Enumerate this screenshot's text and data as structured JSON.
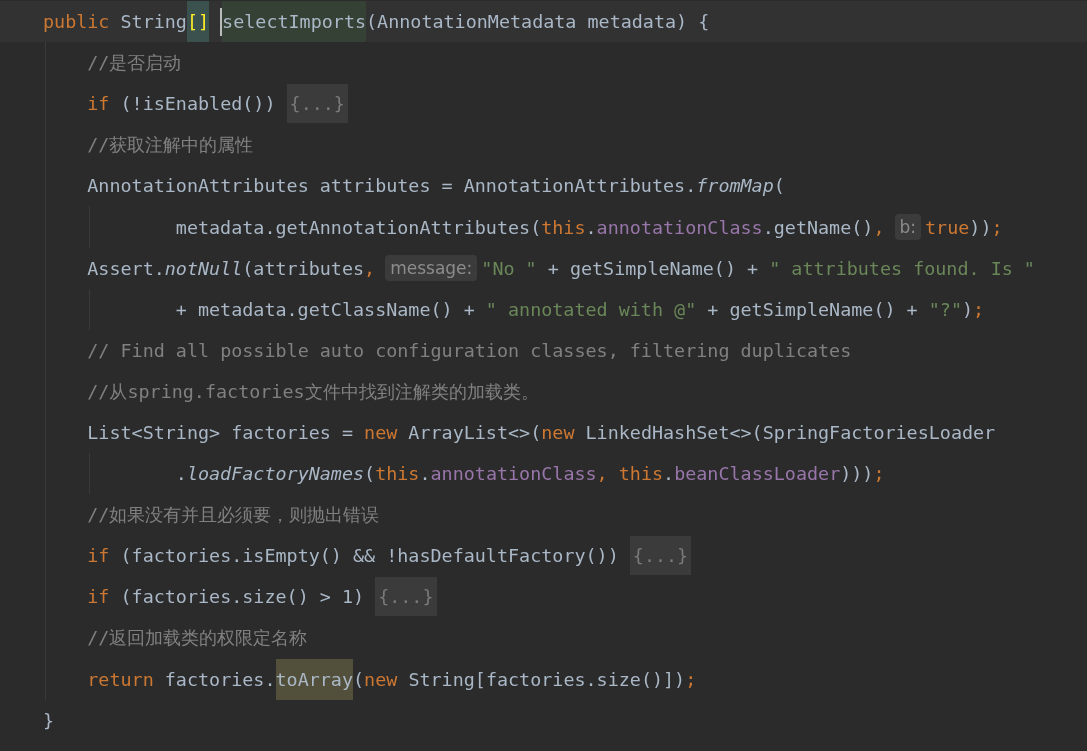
{
  "editor": {
    "lines": [
      {
        "kind": "signature",
        "current": true,
        "tokens": [
          {
            "kind": "keyword",
            "text": "public"
          },
          {
            "kind": "text",
            "text": " String"
          },
          {
            "kind": "brace-match",
            "text": "[]"
          },
          {
            "kind": "declaration-highlight",
            "text": "selectImports",
            "caret": true
          },
          {
            "kind": "text",
            "text": "(AnnotationMetadata metadata) {"
          }
        ]
      },
      {
        "kind": "statement",
        "current": false,
        "tokens": [
          {
            "kind": "comment",
            "text": "//是否启动"
          }
        ]
      },
      {
        "kind": "statement",
        "current": false,
        "tokens": [
          {
            "kind": "keyword",
            "text": "if"
          },
          {
            "kind": "text",
            "text": " (!isEnabled()) "
          },
          {
            "kind": "fold",
            "text": "{...}"
          }
        ]
      },
      {
        "kind": "statement",
        "current": false,
        "tokens": [
          {
            "kind": "comment",
            "text": "//获取注解中的属性"
          }
        ]
      },
      {
        "kind": "statement",
        "current": false,
        "tokens": [
          {
            "kind": "text",
            "text": "AnnotationAttributes attributes = AnnotationAttributes."
          },
          {
            "kind": "static-call",
            "text": "fromMap"
          },
          {
            "kind": "text",
            "text": "("
          }
        ]
      },
      {
        "kind": "continuation",
        "current": false,
        "tokens": [
          {
            "kind": "text",
            "text": "metadata.getAnnotationAttributes("
          },
          {
            "kind": "keyword",
            "text": "this"
          },
          {
            "kind": "text",
            "text": "."
          },
          {
            "kind": "field",
            "text": "annotationClass"
          },
          {
            "kind": "text",
            "text": ".getName()"
          },
          {
            "kind": "keyword",
            "text": ","
          },
          {
            "kind": "hint",
            "text": "b:"
          },
          {
            "kind": "keyword",
            "text": "true"
          },
          {
            "kind": "text",
            "text": "))"
          },
          {
            "kind": "keyword",
            "text": ";"
          }
        ]
      },
      {
        "kind": "statement",
        "current": false,
        "tokens": [
          {
            "kind": "text",
            "text": "Assert."
          },
          {
            "kind": "static-call",
            "text": "notNull"
          },
          {
            "kind": "text",
            "text": "(attributes"
          },
          {
            "kind": "keyword",
            "text": ","
          },
          {
            "kind": "hint",
            "text": "message:"
          },
          {
            "kind": "string",
            "text": "\"No \""
          },
          {
            "kind": "text",
            "text": " + getSimpleName() + "
          },
          {
            "kind": "string",
            "text": "\" attributes found. Is \""
          }
        ]
      },
      {
        "kind": "continuation",
        "current": false,
        "tokens": [
          {
            "kind": "text",
            "text": "+ metadata.getClassName() + "
          },
          {
            "kind": "string",
            "text": "\" annotated with @\""
          },
          {
            "kind": "text",
            "text": " + getSimpleName() + "
          },
          {
            "kind": "string",
            "text": "\"?\""
          },
          {
            "kind": "text",
            "text": ")"
          },
          {
            "kind": "keyword",
            "text": ";"
          }
        ]
      },
      {
        "kind": "statement",
        "current": false,
        "tokens": [
          {
            "kind": "comment",
            "text": "// Find all possible auto configuration classes, filtering duplicates"
          }
        ]
      },
      {
        "kind": "statement",
        "current": false,
        "tokens": [
          {
            "kind": "comment",
            "text": "//从spring.factories文件中找到注解类的加载类。"
          }
        ]
      },
      {
        "kind": "statement",
        "current": false,
        "tokens": [
          {
            "kind": "text",
            "text": "List<String> factories = "
          },
          {
            "kind": "keyword",
            "text": "new"
          },
          {
            "kind": "text",
            "text": " ArrayList<>("
          },
          {
            "kind": "keyword",
            "text": "new"
          },
          {
            "kind": "text",
            "text": " LinkedHashSet<>(SpringFactoriesLoader"
          }
        ]
      },
      {
        "kind": "continuation",
        "current": false,
        "tokens": [
          {
            "kind": "text",
            "text": "."
          },
          {
            "kind": "static-call",
            "text": "loadFactoryNames"
          },
          {
            "kind": "text",
            "text": "("
          },
          {
            "kind": "keyword",
            "text": "this"
          },
          {
            "kind": "text",
            "text": "."
          },
          {
            "kind": "field",
            "text": "annotationClass"
          },
          {
            "kind": "keyword",
            "text": ", this"
          },
          {
            "kind": "text",
            "text": "."
          },
          {
            "kind": "field",
            "text": "beanClassLoader"
          },
          {
            "kind": "text",
            "text": ")))"
          },
          {
            "kind": "keyword",
            "text": ";"
          }
        ]
      },
      {
        "kind": "statement",
        "current": false,
        "tokens": [
          {
            "kind": "comment",
            "text": "//如果没有并且必须要，则抛出错误"
          }
        ]
      },
      {
        "kind": "statement",
        "current": false,
        "tokens": [
          {
            "kind": "keyword",
            "text": "if"
          },
          {
            "kind": "text",
            "text": " (factories.isEmpty() && !hasDefaultFactory()) "
          },
          {
            "kind": "fold",
            "text": "{...}"
          }
        ]
      },
      {
        "kind": "statement",
        "current": false,
        "tokens": [
          {
            "kind": "keyword",
            "text": "if"
          },
          {
            "kind": "text",
            "text": " (factories.size() > 1) "
          },
          {
            "kind": "fold",
            "text": "{...}"
          }
        ]
      },
      {
        "kind": "statement",
        "current": false,
        "tokens": [
          {
            "kind": "comment",
            "text": "//返回加载类的权限定名称"
          }
        ]
      },
      {
        "kind": "statement",
        "current": false,
        "tokens": [
          {
            "kind": "keyword",
            "text": "return"
          },
          {
            "kind": "text",
            "text": " factories."
          },
          {
            "kind": "usage-highlight",
            "text": "toArray"
          },
          {
            "kind": "text",
            "text": "("
          },
          {
            "kind": "keyword",
            "text": "new"
          },
          {
            "kind": "text",
            "text": " String[factories.size()])"
          },
          {
            "kind": "keyword",
            "text": ";"
          }
        ]
      },
      {
        "kind": "close",
        "current": false,
        "tokens": [
          {
            "kind": "text",
            "text": "}"
          }
        ]
      }
    ]
  }
}
